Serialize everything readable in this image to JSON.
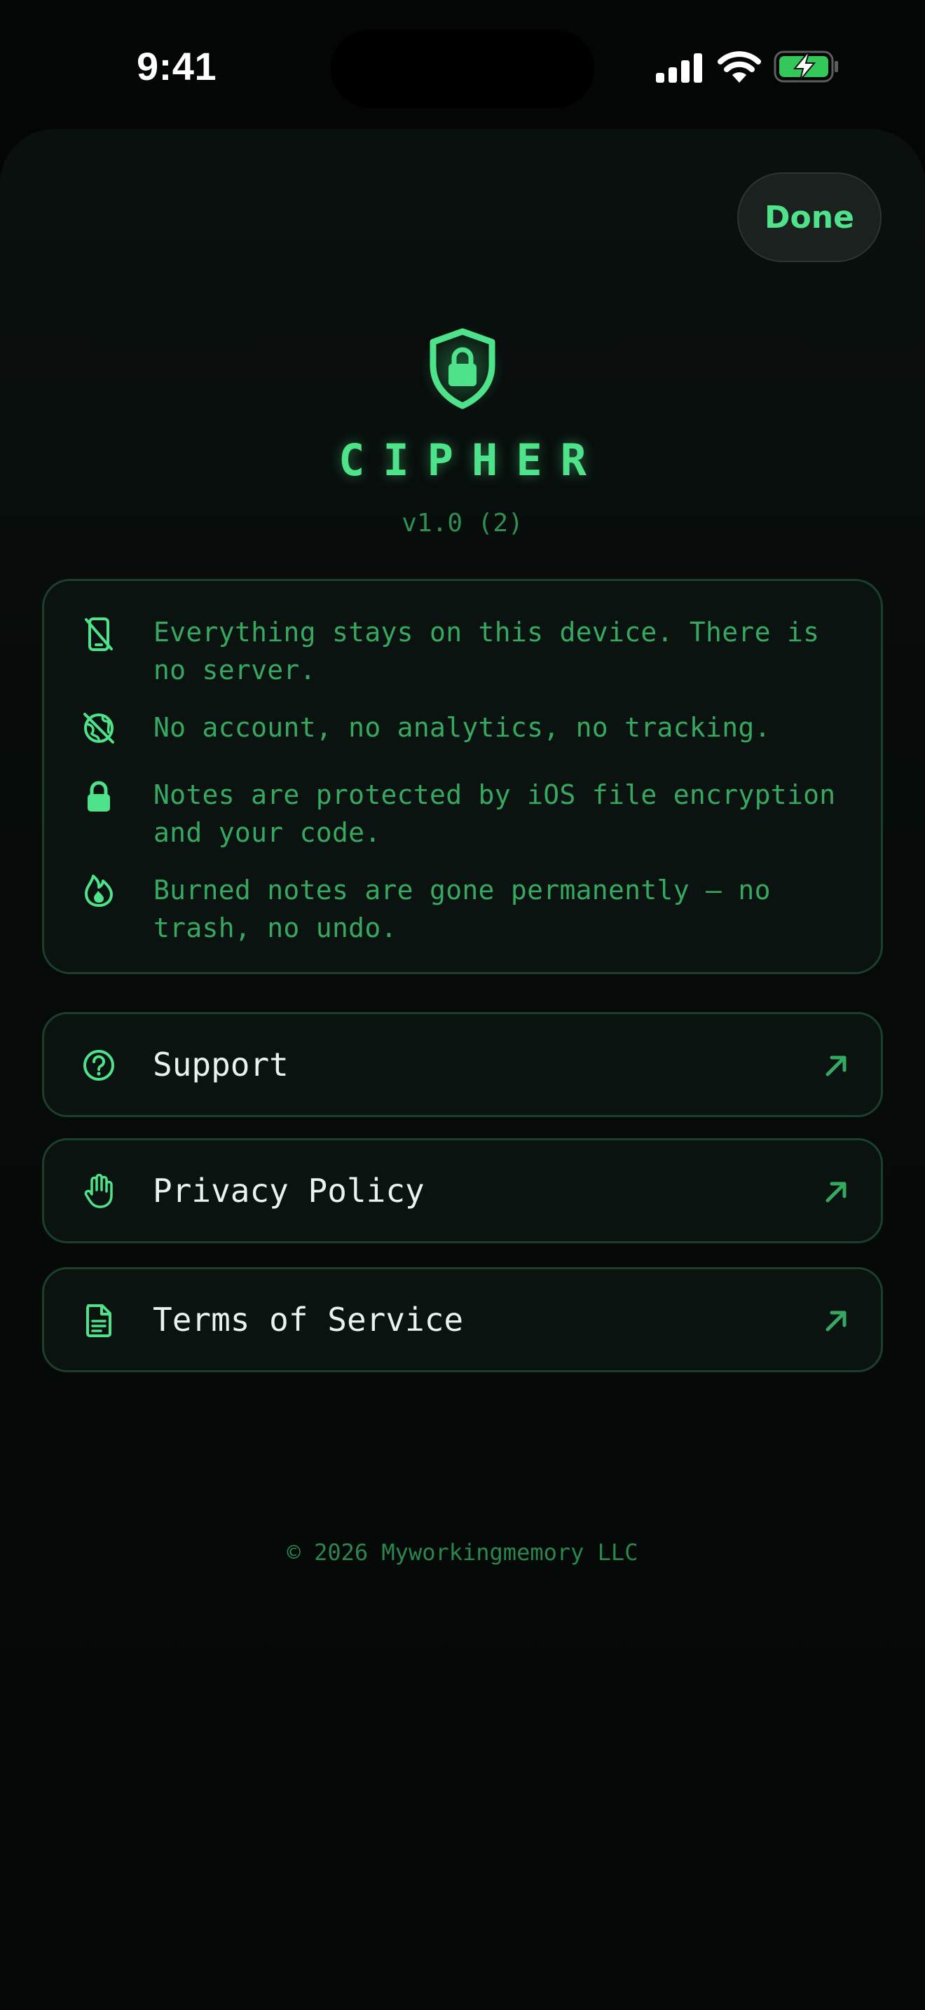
{
  "status_bar": {
    "time": "9:41",
    "icons": [
      "signal-icon",
      "wifi-icon",
      "battery-charging-icon"
    ]
  },
  "sheet": {
    "done_label": "Done",
    "logo_icon": "shield-lock-icon",
    "app_name": "CIPHER",
    "version": "v1.0 (2)"
  },
  "info": {
    "items": [
      {
        "icon": "device-off-icon",
        "text": "Everything stays on this device. There is no server."
      },
      {
        "icon": "globe-off-icon",
        "text": "No account, no analytics, no tracking."
      },
      {
        "icon": "lock-icon",
        "text": "Notes are protected by iOS file encryption and your code."
      },
      {
        "icon": "flame-icon",
        "text": "Burned notes are gone permanently — no trash, no undo."
      }
    ]
  },
  "links": [
    {
      "icon": "question-circle-icon",
      "label": "Support",
      "trailing_icon": "arrow-up-right-icon"
    },
    {
      "icon": "hand-stop-icon",
      "label": "Privacy Policy",
      "trailing_icon": "arrow-up-right-icon"
    },
    {
      "icon": "document-icon",
      "label": "Terms of Service",
      "trailing_icon": "arrow-up-right-icon"
    }
  ],
  "footer": {
    "copyright": "© 2026 Myworkingmemory LLC"
  },
  "colors": {
    "accent": "#4ee38a",
    "accent_dim": "#36a862",
    "background": "#030605",
    "card_background": "#0a130f",
    "card_border": "#1c3f2c",
    "link_text": "#e9f3ee"
  }
}
